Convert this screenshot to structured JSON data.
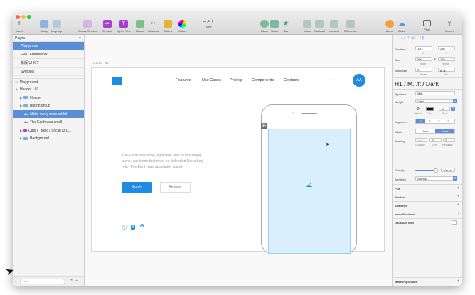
{
  "toolbar": {
    "insert": "Insert",
    "group": "Group",
    "ungroup": "Ungroup",
    "create_symbol": "Create Symbol",
    "symbol": "Symbol",
    "styled_text": "Styled Text",
    "rotate": "Rotate",
    "scissors": "Scissors",
    "outline": "Outline",
    "colors": "Colors",
    "zoom_minus": "–",
    "zoom_plus": "+",
    "zoom_level": "88%",
    "mask": "Mask",
    "scale": "Scale",
    "star": "Star",
    "union": "Union",
    "subtract": "Subtract",
    "intersect": "Intersect",
    "difference": "Difference",
    "mirror": "Mirror",
    "cloud": "Cloud",
    "view": "View",
    "export": "Export"
  },
  "pages": {
    "title": "Pages",
    "items": [
      {
        "label": "Playground",
        "selected": true
      },
      {
        "label": "FWD Framework",
        "selected": false
      },
      {
        "label": "新版 UI KIT",
        "selected": false
      },
      {
        "label": "Symbols",
        "selected": false
      }
    ]
  },
  "layers": {
    "page_name": "Playground",
    "artboard": "Header - 01",
    "items": [
      {
        "label": "Header - 01",
        "type": "artboard"
      },
      {
        "label": "Header",
        "type": "folder"
      },
      {
        "label": "Button group",
        "type": "folder"
      },
      {
        "label": "Make every moment ful",
        "type": "text",
        "selected": true
      },
      {
        "label": "The Earth was small,",
        "type": "text"
      },
      {
        "label": "Data / _Misc / Social (3 L...",
        "type": "symbol"
      },
      {
        "label": "Background",
        "type": "folder"
      }
    ],
    "filter_placeholder": "Filter"
  },
  "canvas": {
    "artboard_label": "Header - 01",
    "nav": [
      "Features",
      "Use Cases",
      "Pricing",
      "Components",
      "Contacts"
    ],
    "avatar": "AA",
    "body_text": "The Earth was small, light blue and so touchingly alone, our home that must be defended like a holy relic. The Earth was absolutely round.",
    "signin": "Sign In",
    "register": "Register"
  },
  "inspector": {
    "position_label": "Position",
    "x": "150",
    "y": "280",
    "x_label": "X",
    "y_label": "Y",
    "size_label": "Size",
    "width": "500",
    "height": "120",
    "width_label": "Width",
    "height_label": "Height",
    "transform_label": "Transform",
    "rotate_value": "0°",
    "rotate_label": "Rotate",
    "flip_label": "Flip",
    "text_style": "H1 / M...ft / Dark",
    "typeface_label": "Typeface",
    "typeface": "Mali",
    "weight_label": "Weight",
    "weight": "Light",
    "options_label": "Options",
    "color_label": "Color",
    "size_value": "40",
    "size_field_label": "Size",
    "alignment_label": "Alignment",
    "width_mode_label": "Width",
    "width_auto": "Auto",
    "width_fixed": "Fixed",
    "spacing_label": "Spacing",
    "char_value": "auto",
    "line_value": "53",
    "para_value": "0",
    "char_label": "Character",
    "line_label": "Line",
    "para_label": "Paragraph",
    "opacity_label": "Opacity",
    "opacity_value": "100 %",
    "opacity": 1.0,
    "blending_label": "Blending",
    "blending": "Normal",
    "fills": "Fills",
    "borders": "Borders",
    "shadows": "Shadows",
    "inner_shadows": "Inner Shadows",
    "gaussian_blur": "Gaussian Blur",
    "make_exportable": "Make Exportable"
  },
  "colors": {
    "accent": "#1f8ce0",
    "selection": "#5a8fd8",
    "phone_screen": "#daeffc"
  }
}
